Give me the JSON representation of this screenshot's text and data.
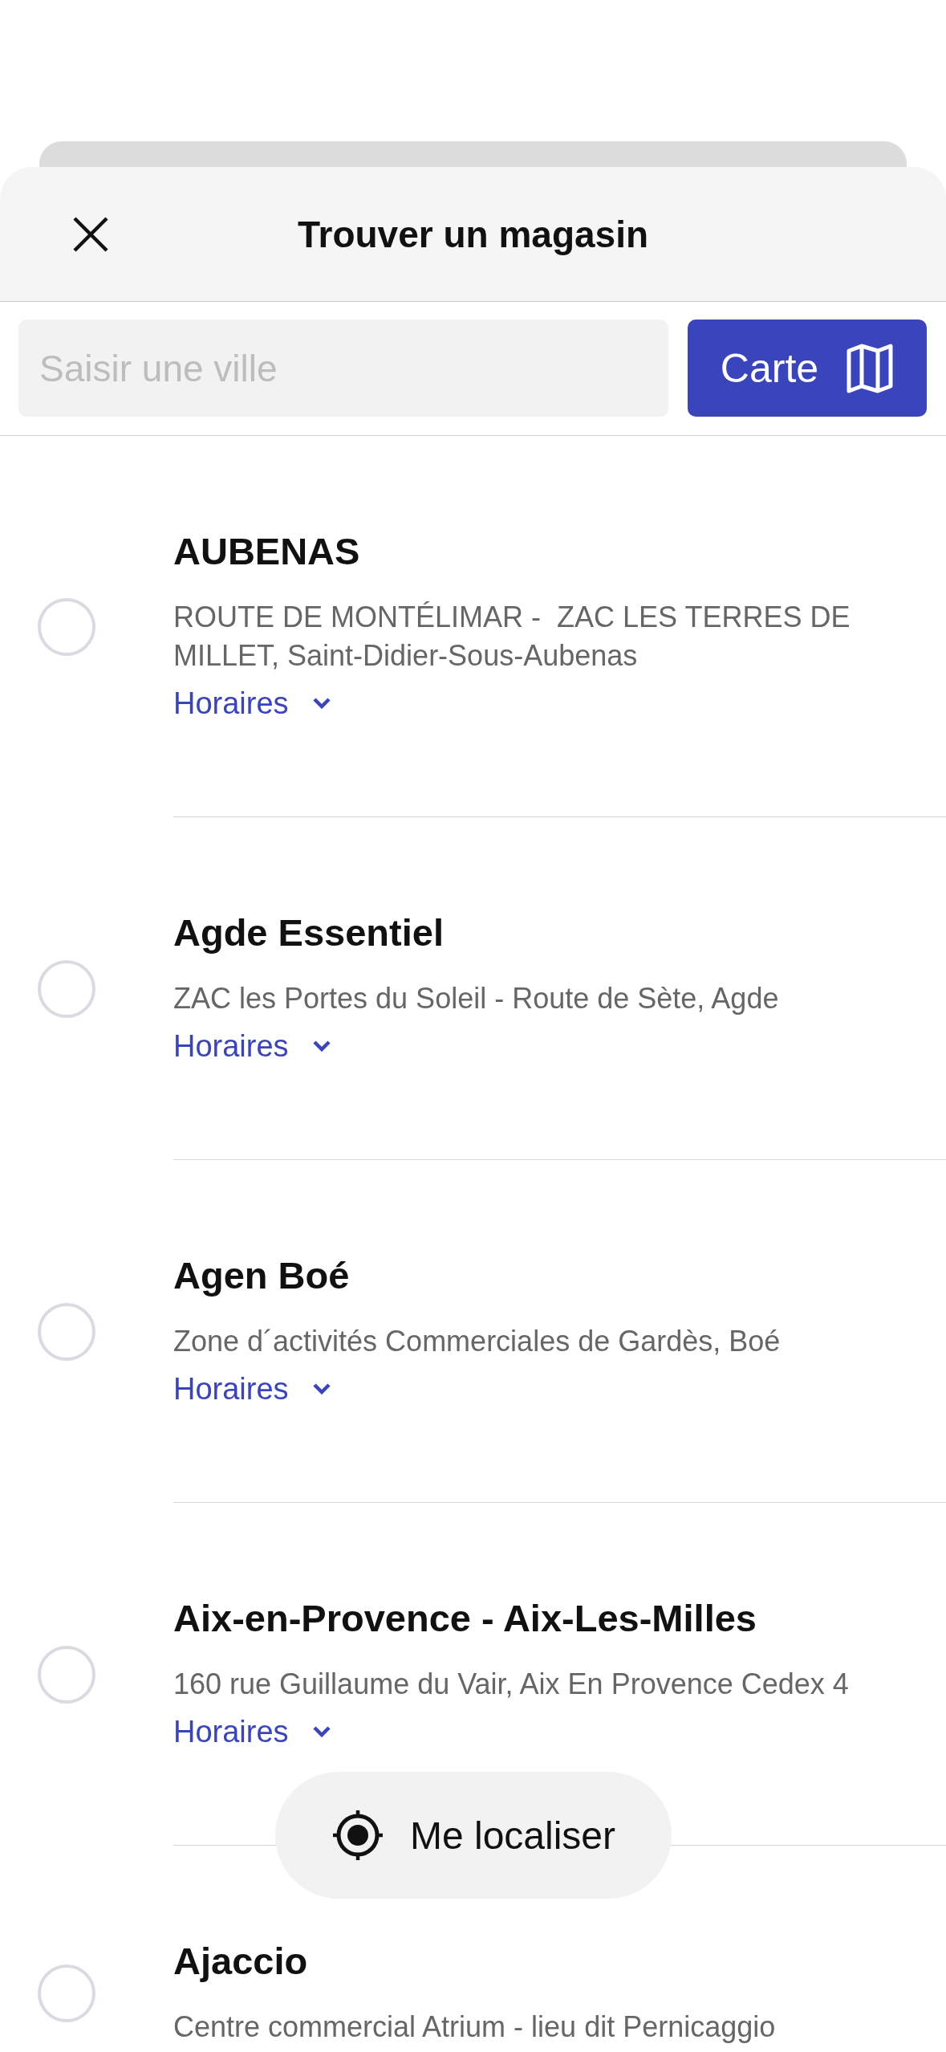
{
  "header": {
    "title": "Trouver un magasin"
  },
  "search": {
    "placeholder": "Saisir une ville",
    "map_button": "Carte"
  },
  "stores": [
    {
      "name": "AUBENAS",
      "address": "ROUTE DE MONTÉLIMAR -  ZAC LES TERRES DE MILLET, Saint-Didier-Sous-Aubenas",
      "hours_link": "Horaires",
      "selected": false,
      "expanded": false
    },
    {
      "name": "Agde Essentiel",
      "address": "ZAC les Portes du Soleil - Route de Sète, Agde",
      "hours_link": "Horaires",
      "selected": false,
      "expanded": false
    },
    {
      "name": "Agen Boé",
      "address": "Zone d´activités Commerciales de Gardès, Boé",
      "hours_link": "Horaires",
      "selected": false,
      "expanded": false
    },
    {
      "name": "Aix-en-Provence - Aix-Les-Milles",
      "address": "160 rue Guillaume du Vair, Aix En Provence Cedex 4",
      "hours_link": "Horaires",
      "selected": false,
      "expanded": false
    },
    {
      "name": "Ajaccio",
      "address": "Centre commercial Atrium - lieu dit Pernicaggio",
      "selected": false
    }
  ],
  "locate_button": "Me localiser"
}
